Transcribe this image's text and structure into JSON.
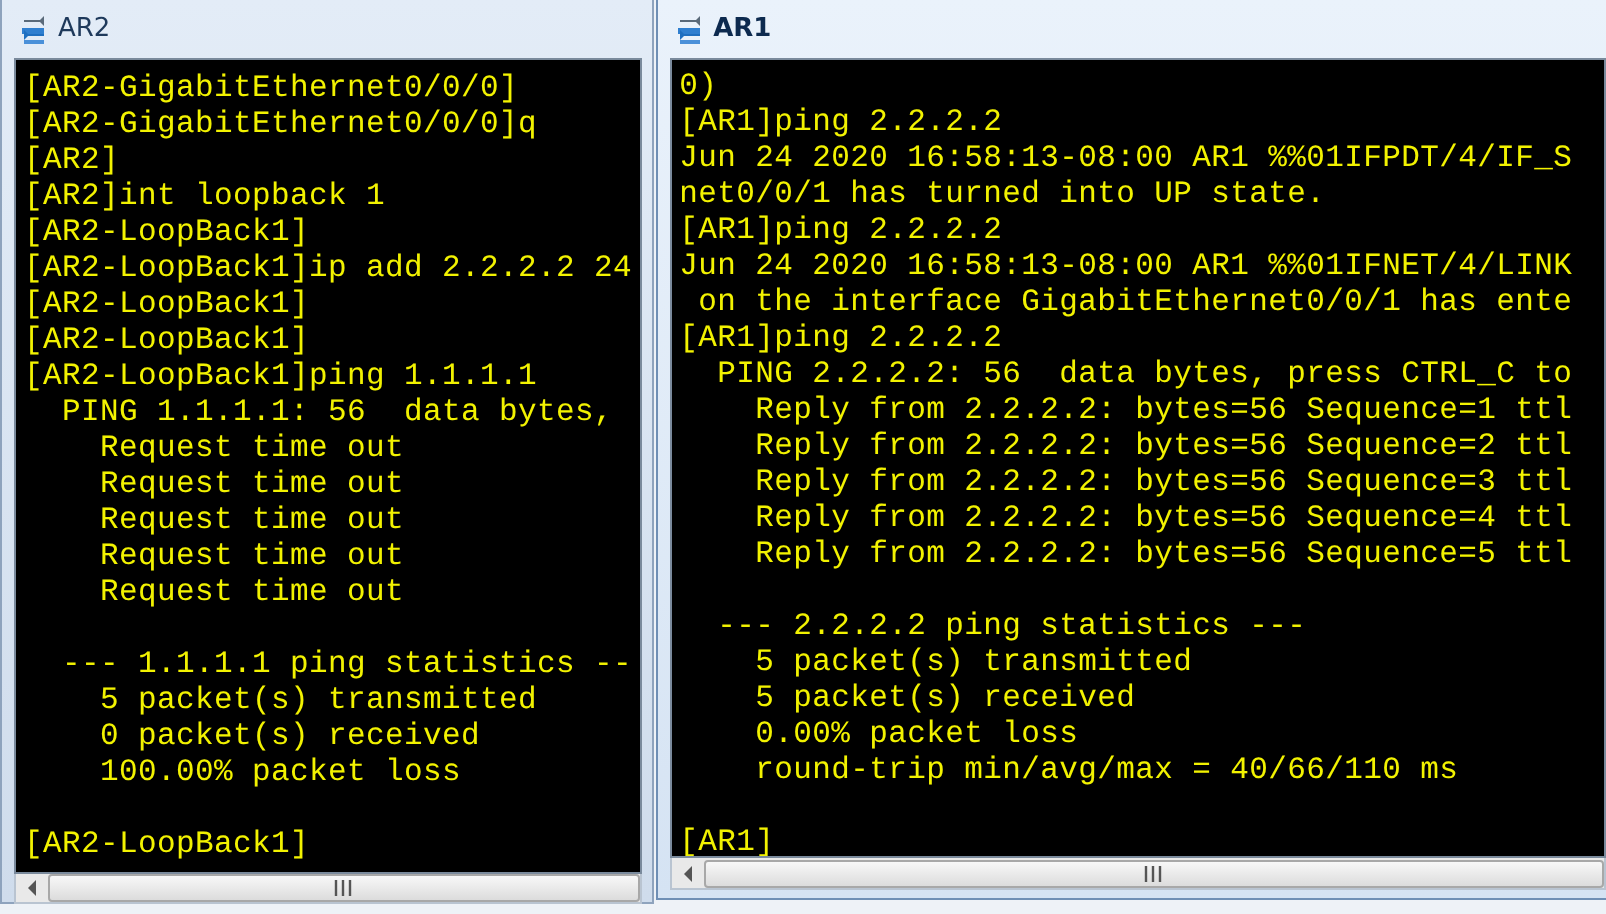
{
  "windows": [
    {
      "title": "AR2",
      "active": false,
      "blocks": [
        [
          "[AR2-GigabitEthernet0/0/0]",
          "[AR2-GigabitEthernet0/0/0]q",
          "[AR2]",
          "[AR2]int loopback 1",
          "[AR2-LoopBack1]",
          "[AR2-LoopBack1]ip add 2.2.2.2 24",
          "[AR2-LoopBack1]",
          "[AR2-LoopBack1]",
          "[AR2-LoopBack1]ping 1.1.1.1",
          "  PING 1.1.1.1: 56  data bytes,",
          "    Request time out",
          "    Request time out",
          "    Request time out",
          "    Request time out",
          "    Request time out"
        ],
        [
          "  --- 1.1.1.1 ping statistics --",
          "    5 packet(s) transmitted",
          "    0 packet(s) received",
          "    100.00% packet loss"
        ],
        [
          "[AR2-LoopBack1]"
        ]
      ]
    },
    {
      "title": "AR1",
      "active": true,
      "blocks": [
        [
          "0)",
          "[AR1]ping 2.2.2.2",
          "Jun 24 2020 16:58:13-08:00 AR1 %%01IFPDT/4/IF_S",
          "net0/0/1 has turned into UP state.",
          "[AR1]ping 2.2.2.2",
          "Jun 24 2020 16:58:13-08:00 AR1 %%01IFNET/4/LINK",
          " on the interface GigabitEthernet0/0/1 has ente",
          "[AR1]ping 2.2.2.2",
          "  PING 2.2.2.2: 56  data bytes, press CTRL_C to",
          "    Reply from 2.2.2.2: bytes=56 Sequence=1 ttl",
          "    Reply from 2.2.2.2: bytes=56 Sequence=2 ttl",
          "    Reply from 2.2.2.2: bytes=56 Sequence=3 ttl",
          "    Reply from 2.2.2.2: bytes=56 Sequence=4 ttl",
          "    Reply from 2.2.2.2: bytes=56 Sequence=5 ttl"
        ],
        [
          "  --- 2.2.2.2 ping statistics ---",
          "    5 packet(s) transmitted",
          "    5 packet(s) received",
          "    0.00% packet loss",
          "    round-trip min/avg/max = 40/66/110 ms"
        ],
        [
          "[AR1]"
        ]
      ]
    }
  ]
}
